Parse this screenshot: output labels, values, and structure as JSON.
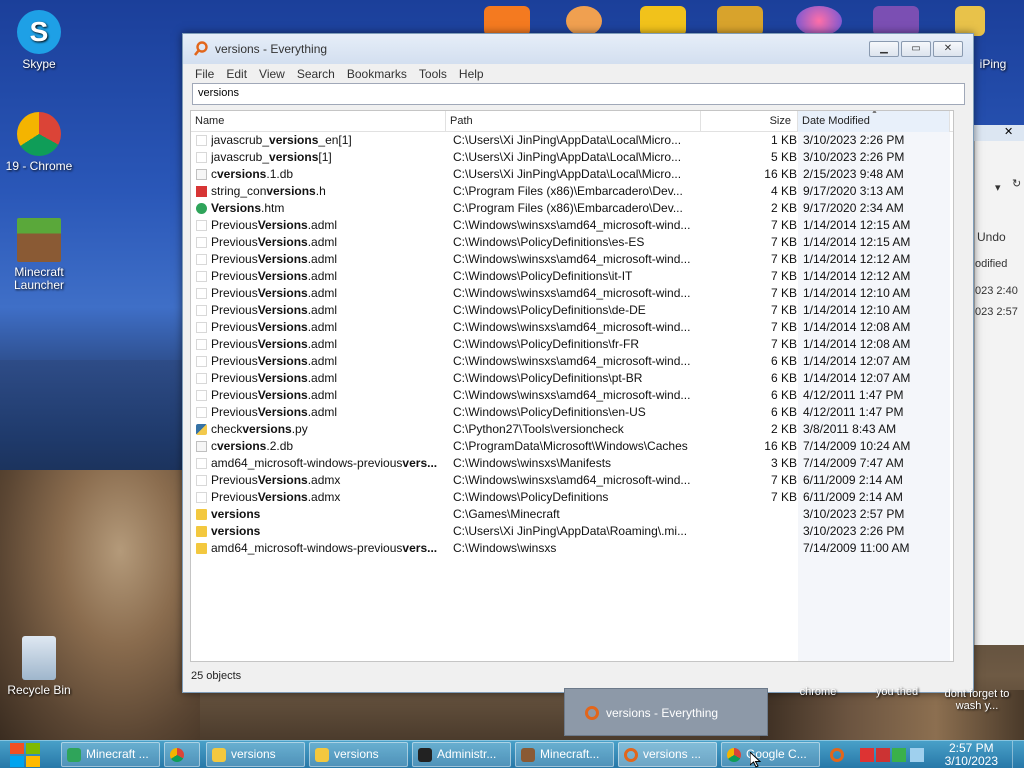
{
  "desktop": {
    "icons": [
      {
        "label": "Skype"
      },
      {
        "label": "19 - Chrome"
      },
      {
        "label": "Minecraft Launcher"
      },
      {
        "label": "Recycle Bin"
      }
    ],
    "partial_label_right": "iPing"
  },
  "window": {
    "title": "versions - Everything",
    "menu": [
      "File",
      "Edit",
      "View",
      "Search",
      "Bookmarks",
      "Tools",
      "Help"
    ],
    "search_value": "versions",
    "columns": {
      "name": "Name",
      "path": "Path",
      "size": "Size",
      "date": "Date Modified"
    },
    "rows": [
      {
        "pre": "javascrub_",
        "bold": "versions",
        "post": "_en[1]",
        "path": "C:\\Users\\Xi JinPing\\AppData\\Local\\Micro...",
        "size": "1 KB",
        "date": "3/10/2023 2:26 PM",
        "icon": "file"
      },
      {
        "pre": "javascrub_",
        "bold": "versions",
        "post": "[1]",
        "path": "C:\\Users\\Xi JinPing\\AppData\\Local\\Micro...",
        "size": "5 KB",
        "date": "3/10/2023 2:26 PM",
        "icon": "file"
      },
      {
        "pre": "c",
        "bold": "versions",
        "post": ".1.db",
        "path": "C:\\Users\\Xi JinPing\\AppData\\Local\\Micro...",
        "size": "16 KB",
        "date": "2/15/2023 9:48 AM",
        "icon": "db"
      },
      {
        "pre": "string_con",
        "bold": "versions",
        "post": ".h",
        "path": "C:\\Program Files (x86)\\Embarcadero\\Dev...",
        "size": "4 KB",
        "date": "9/17/2020 3:13 AM",
        "icon": "h"
      },
      {
        "pre": "",
        "bold": "Versions",
        "post": ".htm",
        "path": "C:\\Program Files (x86)\\Embarcadero\\Dev...",
        "size": "2 KB",
        "date": "9/17/2020 2:34 AM",
        "icon": "htm"
      },
      {
        "pre": "Previous",
        "bold": "Versions",
        "post": ".adml",
        "path": "C:\\Windows\\winsxs\\amd64_microsoft-wind...",
        "size": "7 KB",
        "date": "1/14/2014 12:15 AM",
        "icon": "file"
      },
      {
        "pre": "Previous",
        "bold": "Versions",
        "post": ".adml",
        "path": "C:\\Windows\\PolicyDefinitions\\es-ES",
        "size": "7 KB",
        "date": "1/14/2014 12:15 AM",
        "icon": "file"
      },
      {
        "pre": "Previous",
        "bold": "Versions",
        "post": ".adml",
        "path": "C:\\Windows\\winsxs\\amd64_microsoft-wind...",
        "size": "7 KB",
        "date": "1/14/2014 12:12 AM",
        "icon": "file"
      },
      {
        "pre": "Previous",
        "bold": "Versions",
        "post": ".adml",
        "path": "C:\\Windows\\PolicyDefinitions\\it-IT",
        "size": "7 KB",
        "date": "1/14/2014 12:12 AM",
        "icon": "file"
      },
      {
        "pre": "Previous",
        "bold": "Versions",
        "post": ".adml",
        "path": "C:\\Windows\\winsxs\\amd64_microsoft-wind...",
        "size": "7 KB",
        "date": "1/14/2014 12:10 AM",
        "icon": "file"
      },
      {
        "pre": "Previous",
        "bold": "Versions",
        "post": ".adml",
        "path": "C:\\Windows\\PolicyDefinitions\\de-DE",
        "size": "7 KB",
        "date": "1/14/2014 12:10 AM",
        "icon": "file"
      },
      {
        "pre": "Previous",
        "bold": "Versions",
        "post": ".adml",
        "path": "C:\\Windows\\winsxs\\amd64_microsoft-wind...",
        "size": "7 KB",
        "date": "1/14/2014 12:08 AM",
        "icon": "file"
      },
      {
        "pre": "Previous",
        "bold": "Versions",
        "post": ".adml",
        "path": "C:\\Windows\\PolicyDefinitions\\fr-FR",
        "size": "7 KB",
        "date": "1/14/2014 12:08 AM",
        "icon": "file"
      },
      {
        "pre": "Previous",
        "bold": "Versions",
        "post": ".adml",
        "path": "C:\\Windows\\winsxs\\amd64_microsoft-wind...",
        "size": "6 KB",
        "date": "1/14/2014 12:07 AM",
        "icon": "file"
      },
      {
        "pre": "Previous",
        "bold": "Versions",
        "post": ".adml",
        "path": "C:\\Windows\\PolicyDefinitions\\pt-BR",
        "size": "6 KB",
        "date": "1/14/2014 12:07 AM",
        "icon": "file"
      },
      {
        "pre": "Previous",
        "bold": "Versions",
        "post": ".adml",
        "path": "C:\\Windows\\winsxs\\amd64_microsoft-wind...",
        "size": "6 KB",
        "date": "4/12/2011 1:47 PM",
        "icon": "file"
      },
      {
        "pre": "Previous",
        "bold": "Versions",
        "post": ".adml",
        "path": "C:\\Windows\\PolicyDefinitions\\en-US",
        "size": "6 KB",
        "date": "4/12/2011 1:47 PM",
        "icon": "file"
      },
      {
        "pre": "check",
        "bold": "versions",
        "post": ".py",
        "path": "C:\\Python27\\Tools\\versioncheck",
        "size": "2 KB",
        "date": "3/8/2011 8:43 AM",
        "icon": "py"
      },
      {
        "pre": "c",
        "bold": "versions",
        "post": ".2.db",
        "path": "C:\\ProgramData\\Microsoft\\Windows\\Caches",
        "size": "16 KB",
        "date": "7/14/2009 10:24 AM",
        "icon": "db"
      },
      {
        "pre": "amd64_microsoft-windows-previous",
        "bold": "vers...",
        "post": "",
        "path": "C:\\Windows\\winsxs\\Manifests",
        "size": "3 KB",
        "date": "7/14/2009 7:47 AM",
        "icon": "file"
      },
      {
        "pre": "Previous",
        "bold": "Versions",
        "post": ".admx",
        "path": "C:\\Windows\\winsxs\\amd64_microsoft-wind...",
        "size": "7 KB",
        "date": "6/11/2009 2:14 AM",
        "icon": "file"
      },
      {
        "pre": "Previous",
        "bold": "Versions",
        "post": ".admx",
        "path": "C:\\Windows\\PolicyDefinitions",
        "size": "7 KB",
        "date": "6/11/2009 2:14 AM",
        "icon": "file"
      },
      {
        "pre": "",
        "bold": "versions",
        "post": "",
        "path": "C:\\Games\\Minecraft",
        "size": "",
        "date": "3/10/2023 2:57 PM",
        "icon": "folder"
      },
      {
        "pre": "",
        "bold": "versions",
        "post": "",
        "path": "C:\\Users\\Xi JinPing\\AppData\\Roaming\\.mi...",
        "size": "",
        "date": "3/10/2023 2:26 PM",
        "icon": "folder"
      },
      {
        "pre": "amd64_microsoft-windows-previous",
        "bold": "vers...",
        "post": "",
        "path": "C:\\Windows\\winsxs",
        "size": "",
        "date": "7/14/2009 11:00 AM",
        "icon": "folder"
      }
    ],
    "status": "25 objects"
  },
  "background_window": {
    "undo": "Undo",
    "modified": "odified",
    "date1": "023 2:40",
    "date2": "023 2:57"
  },
  "popup": {
    "title": "versions - Everything"
  },
  "thumbs": [
    {
      "label": "chrome"
    },
    {
      "label": "you thed"
    },
    {
      "label": "dont forget to wash y..."
    }
  ],
  "taskbar": {
    "items": [
      {
        "label": "Minecraft ..."
      },
      {
        "label": ""
      },
      {
        "label": "versions"
      },
      {
        "label": "versions"
      },
      {
        "label": "Administr..."
      },
      {
        "label": "Minecraft..."
      },
      {
        "label": "versions ..."
      },
      {
        "label": "Google C..."
      }
    ],
    "time": "2:57 PM",
    "date": "3/10/2023"
  }
}
